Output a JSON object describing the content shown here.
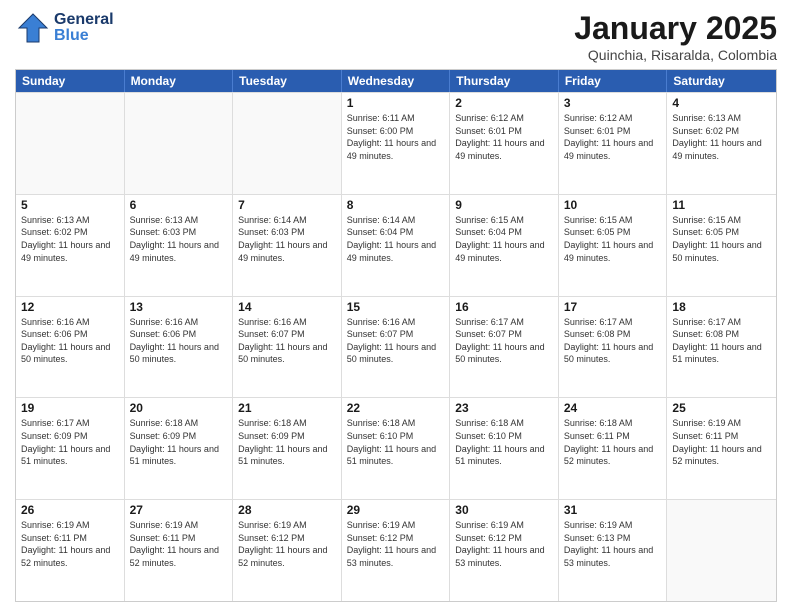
{
  "header": {
    "logo_general": "General",
    "logo_blue": "Blue",
    "month_title": "January 2025",
    "location": "Quinchia, Risaralda, Colombia"
  },
  "days_of_week": [
    "Sunday",
    "Monday",
    "Tuesday",
    "Wednesday",
    "Thursday",
    "Friday",
    "Saturday"
  ],
  "weeks": [
    [
      {
        "day": "",
        "empty": true
      },
      {
        "day": "",
        "empty": true
      },
      {
        "day": "",
        "empty": true
      },
      {
        "day": "1",
        "sunrise": "6:11 AM",
        "sunset": "6:00 PM",
        "daylight": "11 hours and 49 minutes."
      },
      {
        "day": "2",
        "sunrise": "6:12 AM",
        "sunset": "6:01 PM",
        "daylight": "11 hours and 49 minutes."
      },
      {
        "day": "3",
        "sunrise": "6:12 AM",
        "sunset": "6:01 PM",
        "daylight": "11 hours and 49 minutes."
      },
      {
        "day": "4",
        "sunrise": "6:13 AM",
        "sunset": "6:02 PM",
        "daylight": "11 hours and 49 minutes."
      }
    ],
    [
      {
        "day": "5",
        "sunrise": "6:13 AM",
        "sunset": "6:02 PM",
        "daylight": "11 hours and 49 minutes."
      },
      {
        "day": "6",
        "sunrise": "6:13 AM",
        "sunset": "6:03 PM",
        "daylight": "11 hours and 49 minutes."
      },
      {
        "day": "7",
        "sunrise": "6:14 AM",
        "sunset": "6:03 PM",
        "daylight": "11 hours and 49 minutes."
      },
      {
        "day": "8",
        "sunrise": "6:14 AM",
        "sunset": "6:04 PM",
        "daylight": "11 hours and 49 minutes."
      },
      {
        "day": "9",
        "sunrise": "6:15 AM",
        "sunset": "6:04 PM",
        "daylight": "11 hours and 49 minutes."
      },
      {
        "day": "10",
        "sunrise": "6:15 AM",
        "sunset": "6:05 PM",
        "daylight": "11 hours and 49 minutes."
      },
      {
        "day": "11",
        "sunrise": "6:15 AM",
        "sunset": "6:05 PM",
        "daylight": "11 hours and 50 minutes."
      }
    ],
    [
      {
        "day": "12",
        "sunrise": "6:16 AM",
        "sunset": "6:06 PM",
        "daylight": "11 hours and 50 minutes."
      },
      {
        "day": "13",
        "sunrise": "6:16 AM",
        "sunset": "6:06 PM",
        "daylight": "11 hours and 50 minutes."
      },
      {
        "day": "14",
        "sunrise": "6:16 AM",
        "sunset": "6:07 PM",
        "daylight": "11 hours and 50 minutes."
      },
      {
        "day": "15",
        "sunrise": "6:16 AM",
        "sunset": "6:07 PM",
        "daylight": "11 hours and 50 minutes."
      },
      {
        "day": "16",
        "sunrise": "6:17 AM",
        "sunset": "6:07 PM",
        "daylight": "11 hours and 50 minutes."
      },
      {
        "day": "17",
        "sunrise": "6:17 AM",
        "sunset": "6:08 PM",
        "daylight": "11 hours and 50 minutes."
      },
      {
        "day": "18",
        "sunrise": "6:17 AM",
        "sunset": "6:08 PM",
        "daylight": "11 hours and 51 minutes."
      }
    ],
    [
      {
        "day": "19",
        "sunrise": "6:17 AM",
        "sunset": "6:09 PM",
        "daylight": "11 hours and 51 minutes."
      },
      {
        "day": "20",
        "sunrise": "6:18 AM",
        "sunset": "6:09 PM",
        "daylight": "11 hours and 51 minutes."
      },
      {
        "day": "21",
        "sunrise": "6:18 AM",
        "sunset": "6:09 PM",
        "daylight": "11 hours and 51 minutes."
      },
      {
        "day": "22",
        "sunrise": "6:18 AM",
        "sunset": "6:10 PM",
        "daylight": "11 hours and 51 minutes."
      },
      {
        "day": "23",
        "sunrise": "6:18 AM",
        "sunset": "6:10 PM",
        "daylight": "11 hours and 51 minutes."
      },
      {
        "day": "24",
        "sunrise": "6:18 AM",
        "sunset": "6:11 PM",
        "daylight": "11 hours and 52 minutes."
      },
      {
        "day": "25",
        "sunrise": "6:19 AM",
        "sunset": "6:11 PM",
        "daylight": "11 hours and 52 minutes."
      }
    ],
    [
      {
        "day": "26",
        "sunrise": "6:19 AM",
        "sunset": "6:11 PM",
        "daylight": "11 hours and 52 minutes."
      },
      {
        "day": "27",
        "sunrise": "6:19 AM",
        "sunset": "6:11 PM",
        "daylight": "11 hours and 52 minutes."
      },
      {
        "day": "28",
        "sunrise": "6:19 AM",
        "sunset": "6:12 PM",
        "daylight": "11 hours and 52 minutes."
      },
      {
        "day": "29",
        "sunrise": "6:19 AM",
        "sunset": "6:12 PM",
        "daylight": "11 hours and 53 minutes."
      },
      {
        "day": "30",
        "sunrise": "6:19 AM",
        "sunset": "6:12 PM",
        "daylight": "11 hours and 53 minutes."
      },
      {
        "day": "31",
        "sunrise": "6:19 AM",
        "sunset": "6:13 PM",
        "daylight": "11 hours and 53 minutes."
      },
      {
        "day": "",
        "empty": true
      }
    ]
  ]
}
